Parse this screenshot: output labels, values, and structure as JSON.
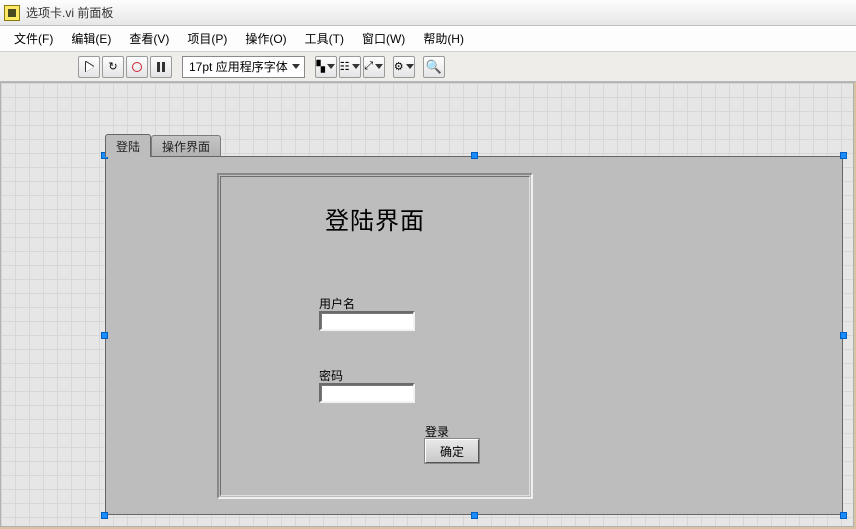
{
  "window": {
    "title": "选项卡.vi 前面板"
  },
  "menu": {
    "items": [
      "文件(F)",
      "编辑(E)",
      "查看(V)",
      "项目(P)",
      "操作(O)",
      "工具(T)",
      "窗口(W)",
      "帮助(H)"
    ]
  },
  "toolbar": {
    "font_label": "17pt 应用程序字体"
  },
  "tabs": {
    "items": [
      {
        "label": "登陆",
        "active": true
      },
      {
        "label": "操作界面",
        "active": false
      }
    ]
  },
  "login": {
    "title": "登陆界面",
    "username_label": "用户名",
    "password_label": "密码",
    "login_caption": "登录",
    "ok_label": "确定"
  }
}
